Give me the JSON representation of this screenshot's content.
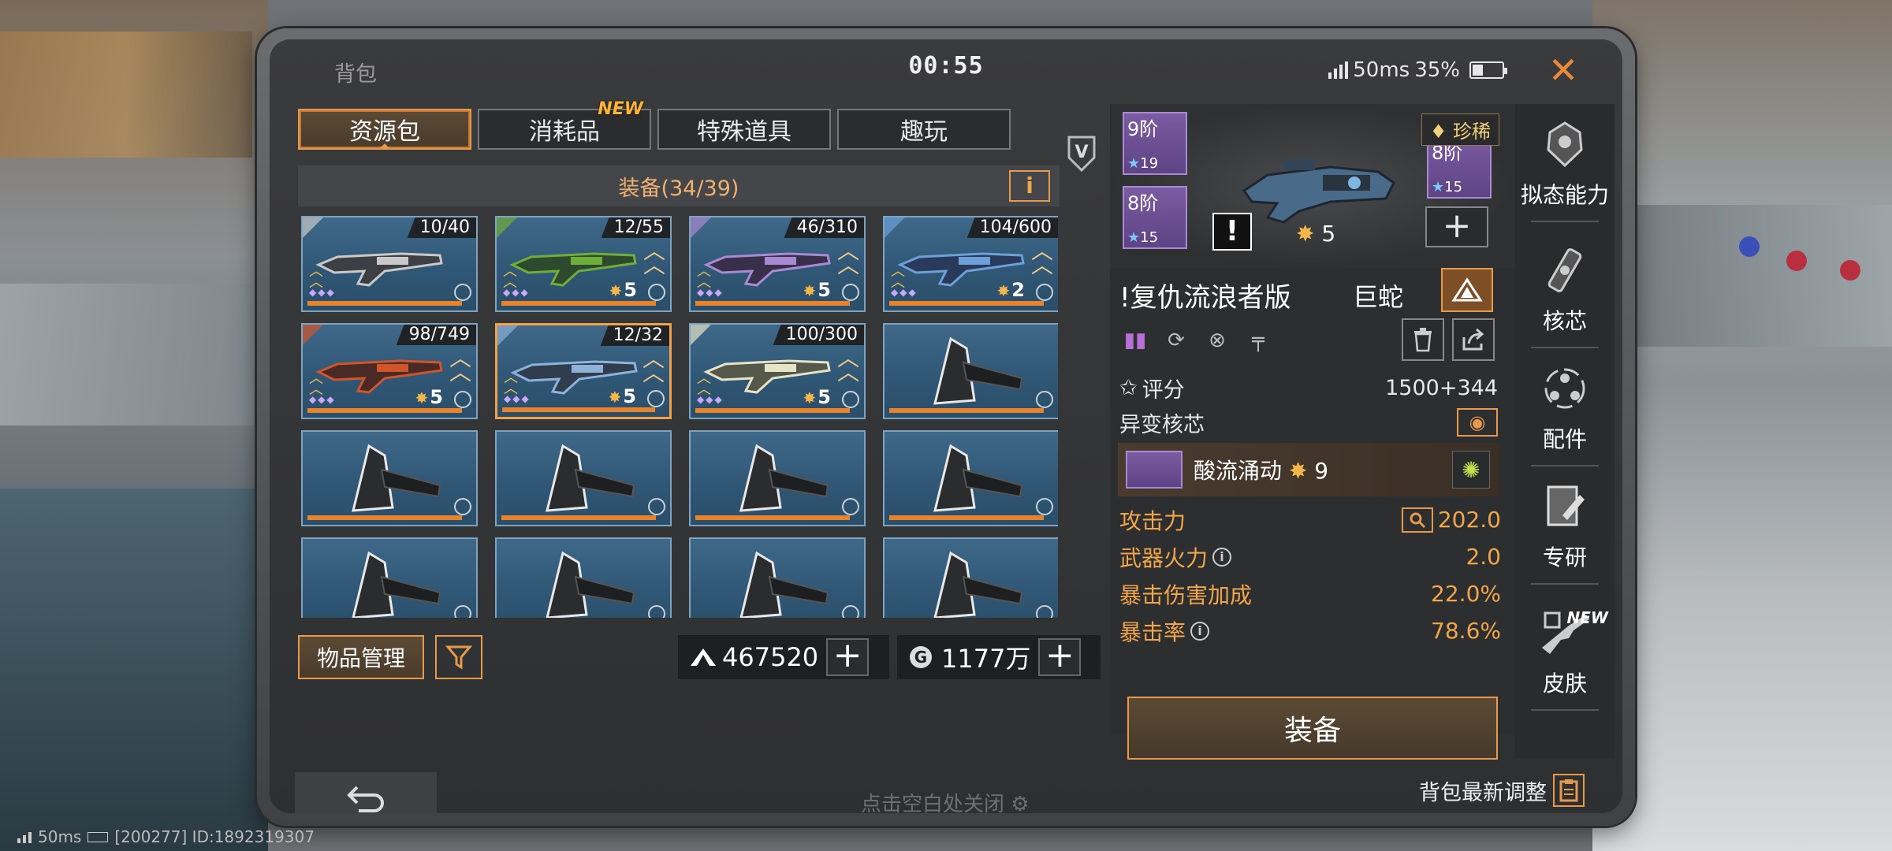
{
  "header": {
    "title": "背包",
    "clock": "00:55",
    "ping": "50ms",
    "battery": "35%",
    "battery_level": 0.35
  },
  "tabs": [
    {
      "label": "资源包",
      "active": true
    },
    {
      "label": "消耗品",
      "new": "NEW"
    },
    {
      "label": "特殊道具"
    },
    {
      "label": "趣玩"
    }
  ],
  "v_badge": "V",
  "inventory": {
    "section_title": "装备(34/39)",
    "info_label": "i",
    "items": [
      {
        "count": "10/40",
        "level": "",
        "kind": "sniper"
      },
      {
        "count": "12/55",
        "level": "5",
        "kind": "rifle-green"
      },
      {
        "count": "46/310",
        "level": "5",
        "kind": "rifle-purple"
      },
      {
        "count": "104/600",
        "level": "2",
        "kind": "rifle-blue"
      },
      {
        "count": "98/749",
        "level": "5",
        "kind": "rifle-red"
      },
      {
        "count": "12/32",
        "level": "5",
        "kind": "launcher",
        "selected": true
      },
      {
        "count": "100/300",
        "level": "5",
        "kind": "smg-cream"
      },
      {
        "count": "",
        "level": "",
        "kind": "axe"
      },
      {
        "count": "",
        "level": "",
        "kind": "axe"
      },
      {
        "count": "",
        "level": "",
        "kind": "axe"
      },
      {
        "count": "",
        "level": "",
        "kind": "axe"
      },
      {
        "count": "",
        "level": "",
        "kind": "axe"
      },
      {
        "count": "",
        "level": "",
        "kind": "axe"
      },
      {
        "count": "",
        "level": "",
        "kind": "axe"
      },
      {
        "count": "",
        "level": "",
        "kind": "axe"
      },
      {
        "count": "",
        "level": "",
        "kind": "axe"
      }
    ],
    "manage_label": "物品管理",
    "currency1": "467520",
    "currency2": "1177万",
    "plus": "+"
  },
  "footer_hint": "点击空白处关闭",
  "detail": {
    "parts": [
      {
        "tier": "9阶",
        "value": "19"
      },
      {
        "tier": "8阶",
        "value": "15"
      },
      {
        "tier": "8阶",
        "value": "15"
      }
    ],
    "rarity": "珍稀",
    "exclaim": "!",
    "weapon_level": "5",
    "weapon_name": "!复仇流浪者版",
    "weapon_name2": "巨蛇",
    "score_label": "评分",
    "score_value": "1500+344",
    "core_label": "异变核芯",
    "core_item_name": "酸流涌动",
    "core_item_level": "9",
    "stats": [
      {
        "label": "攻击力",
        "value": "202.0",
        "info": false,
        "search": true
      },
      {
        "label": "武器火力",
        "value": "2.0",
        "info": true
      },
      {
        "label": "暴击伤害加成",
        "value": "22.0%",
        "info": false
      },
      {
        "label": "暴击率",
        "value": "78.6%",
        "info": true
      }
    ],
    "equip_label": "装备"
  },
  "sidenav": [
    {
      "label": "拟态能力"
    },
    {
      "label": "核芯"
    },
    {
      "label": "配件"
    },
    {
      "label": "专研"
    },
    {
      "label": "皮肤",
      "new": "NEW"
    }
  ],
  "adjust_label": "背包最新调整",
  "bottom_status": {
    "ping": "50ms",
    "server": "[200277] ID:1892319307"
  },
  "colors": {
    "accent": "#e59a4d",
    "cell_bg": "#35607f",
    "panel_bg": "#333436"
  }
}
